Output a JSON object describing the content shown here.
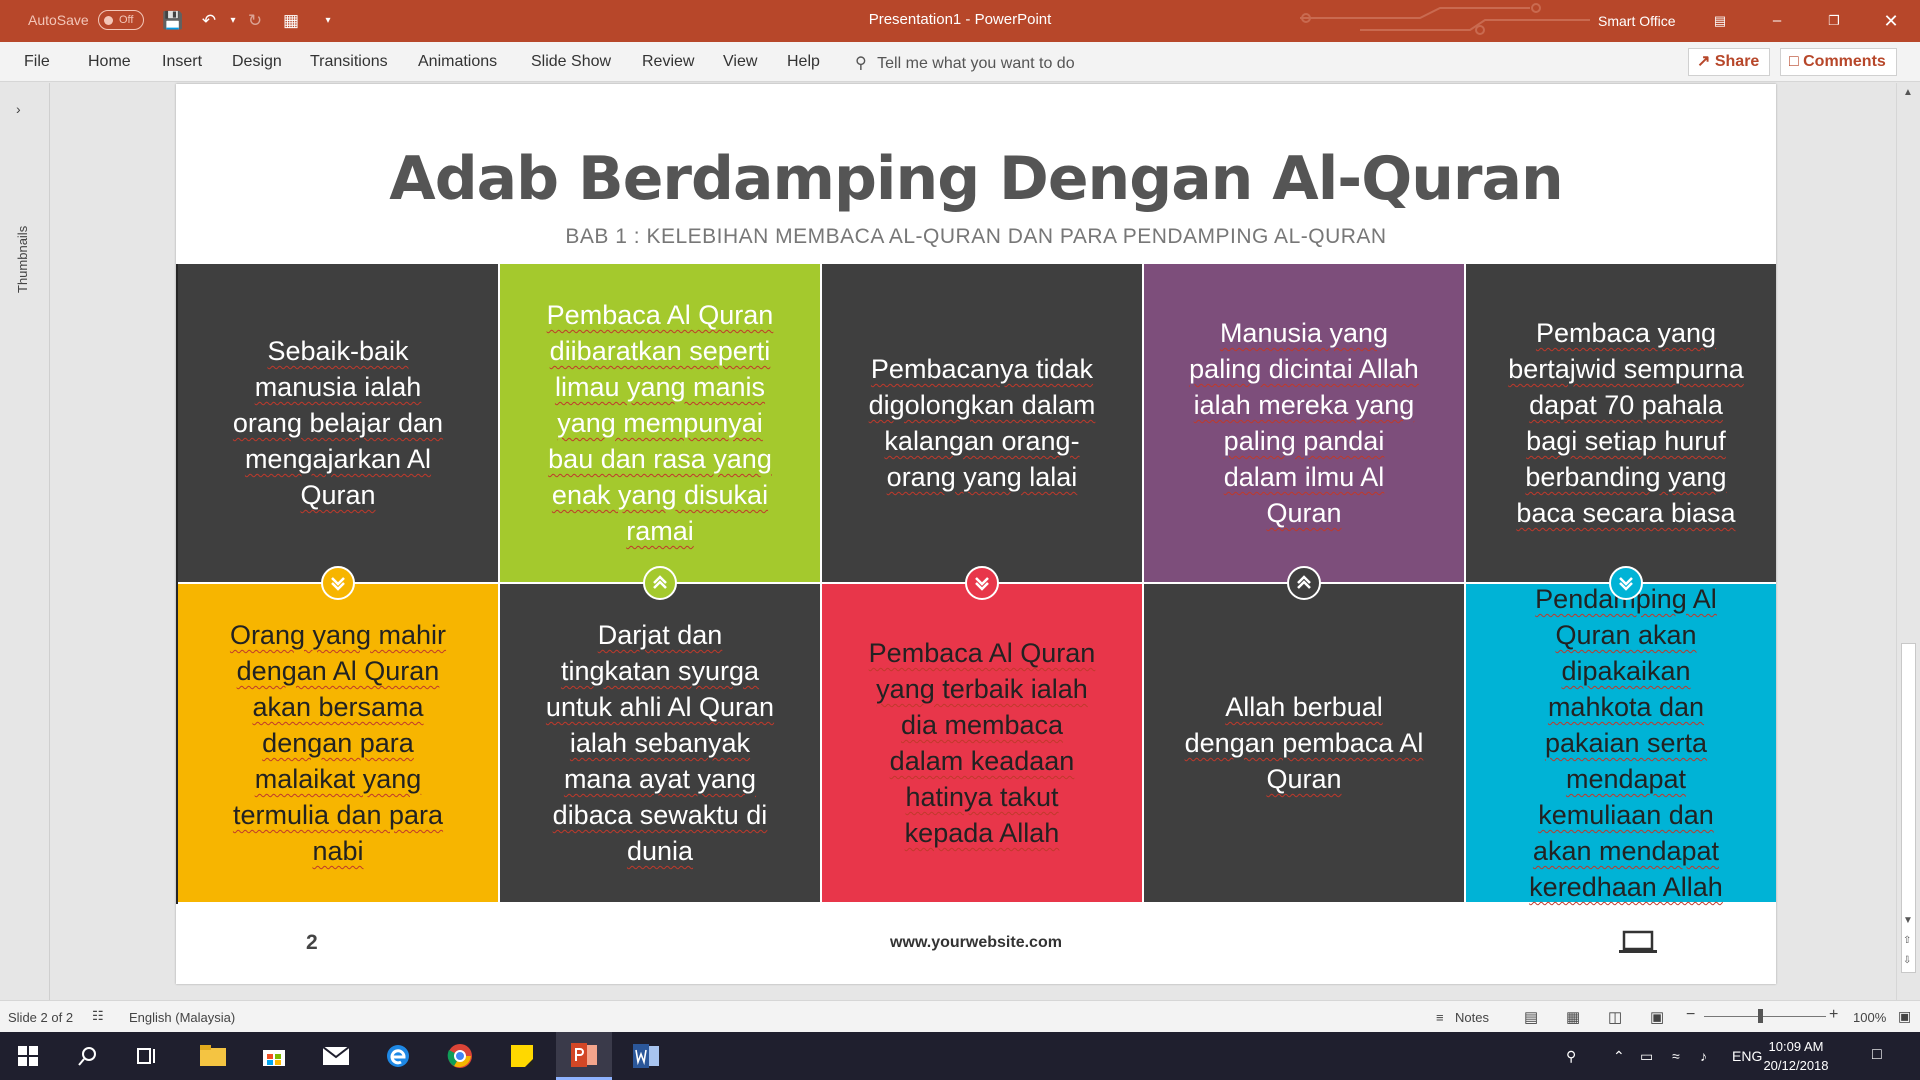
{
  "window": {
    "autosave_label": "AutoSave",
    "autosave_state": "Off",
    "title": "Presentation1  -  PowerPoint",
    "user": "Smart Office"
  },
  "ribbon": {
    "tabs": [
      "File",
      "Home",
      "Insert",
      "Design",
      "Transitions",
      "Animations",
      "Slide Show",
      "Review",
      "View",
      "Help"
    ],
    "tell_me": "Tell me what you want to do",
    "share": "Share",
    "comments": "Comments"
  },
  "thumbnails_label": "Thumbnails",
  "slide": {
    "title": "Adab Berdamping Dengan Al-Quran",
    "subtitle": "BAB 1 : KELEBIHAN MEMBACA AL-QURAN DAN PARA PENDAMPING AL-QURAN",
    "top_cells": [
      {
        "text": "Sebaik-baik manusia ialah orang belajar dan mengajarkan Al Quran",
        "color": "#3f3f3f",
        "icon": "chevron-down-icon",
        "icon_color": "#f7b500"
      },
      {
        "text": "Pembaca Al Quran diibaratkan seperti limau yang manis yang mempunyai bau dan rasa yang enak yang disukai ramai",
        "color": "#a4c92d",
        "icon": "chevron-up-icon",
        "icon_color": "#a4c92d"
      },
      {
        "text": "Pembacanya tidak digolongkan dalam kalangan orang-orang yang lalai",
        "color": "#3f3f3f",
        "icon": "chevron-down-icon",
        "icon_color": "#e8364a"
      },
      {
        "text": "Manusia yang paling dicintai Allah ialah mereka yang paling pandai dalam ilmu Al Quran",
        "color": "#7d4e7b",
        "icon": "chevron-up-icon",
        "icon_color": "#3f3f3f"
      },
      {
        "text": "Pembaca yang bertajwid sempurna dapat 70 pahala bagi setiap huruf berbanding yang baca secara biasa",
        "color": "#3f3f3f",
        "icon": "chevron-down-icon",
        "icon_color": "#00b3d6"
      }
    ],
    "bottom_cells": [
      {
        "text": "Orang yang mahir dengan Al Quran akan bersama dengan para malaikat yang termulia dan para nabi",
        "color": "#f7b500",
        "text_color": "#222222"
      },
      {
        "text": "Darjat dan tingkatan syurga untuk ahli Al Quran ialah sebanyak mana ayat yang dibaca sewaktu di dunia",
        "color": "#3f3f3f",
        "text_color": "#ffffff"
      },
      {
        "text": "Pembaca Al Quran yang terbaik ialah dia membaca dalam keadaan hatinya takut kepada Allah",
        "color": "#e8364a",
        "text_color": "#222222"
      },
      {
        "text": "Allah berbual dengan pembaca Al Quran",
        "color": "#3f3f3f",
        "text_color": "#ffffff"
      },
      {
        "text": "Pendamping Al Quran akan dipakaikan mahkota dan pakaian serta mendapat kemuliaan dan akan mendapat keredhaan Allah",
        "color": "#00b3d6",
        "text_color": "#222222"
      }
    ],
    "page_number": "2",
    "website": "www.yourwebsite.com"
  },
  "status": {
    "slide_counter": "Slide 2 of 2",
    "language": "English (Malaysia)",
    "notes": "Notes",
    "zoom": "100%"
  },
  "taskbar": {
    "language": "ENG",
    "time": "10:09 AM",
    "date": "20/12/2018"
  },
  "colors": {
    "ppt_accent": "#b7472a"
  }
}
